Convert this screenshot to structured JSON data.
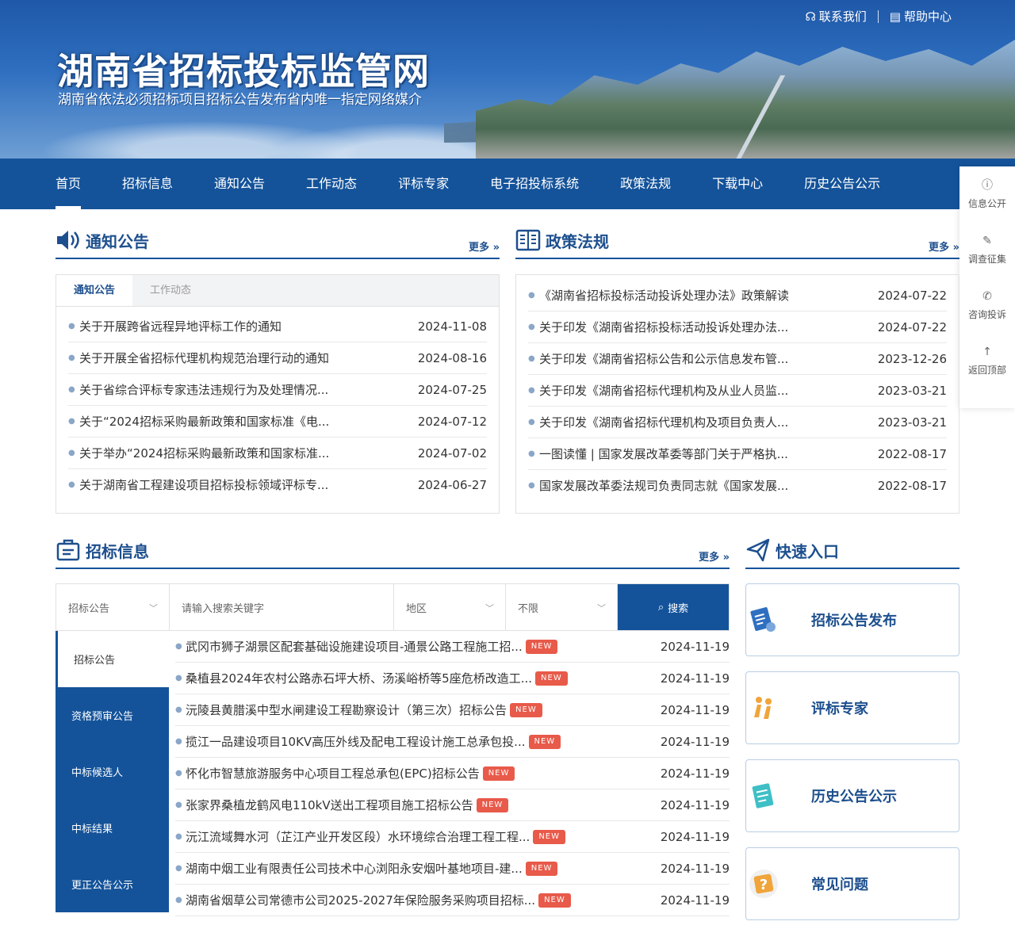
{
  "header": {
    "title": "湖南省招标投标监管网",
    "subtitle": "湖南省依法必须招标项目招标公告发布省内唯一指定网络媒介",
    "links": [
      "联系我们",
      "帮助中心"
    ]
  },
  "nav": [
    "首页",
    "招标信息",
    "通知公告",
    "工作动态",
    "评标专家",
    "电子招投标系统",
    "政策法规",
    "下载中心",
    "历史公告公示"
  ],
  "sidebar": [
    "信息公开",
    "调查征集",
    "咨询投诉",
    "返回顶部"
  ],
  "notices": {
    "title": "通知公告",
    "more": "更多",
    "tabs": [
      "通知公告",
      "工作动态"
    ],
    "items": [
      {
        "title": "关于开展跨省远程异地评标工作的通知",
        "date": "2024-11-08"
      },
      {
        "title": "关于开展全省招标代理机构规范治理行动的通知",
        "date": "2024-08-16"
      },
      {
        "title": "关于省综合评标专家违法违规行为及处理情况...",
        "date": "2024-07-25"
      },
      {
        "title": "关于“2024招标采购最新政策和国家标准《电...",
        "date": "2024-07-12"
      },
      {
        "title": "关于举办“2024招标采购最新政策和国家标准...",
        "date": "2024-07-02"
      },
      {
        "title": "关于湖南省工程建设项目招标投标领域评标专...",
        "date": "2024-06-27"
      }
    ]
  },
  "policy": {
    "title": "政策法规",
    "more": "更多",
    "items": [
      {
        "title": "《湖南省招标投标活动投诉处理办法》政策解读",
        "date": "2024-07-22"
      },
      {
        "title": "关于印发《湖南省招标投标活动投诉处理办法...",
        "date": "2024-07-22"
      },
      {
        "title": "关于印发《湖南省招标公告和公示信息发布管...",
        "date": "2023-12-26"
      },
      {
        "title": "关于印发《湖南省招标代理机构及从业人员监...",
        "date": "2023-03-21"
      },
      {
        "title": "关于印发《湖南省招标代理机构及项目负责人...",
        "date": "2023-03-21"
      },
      {
        "title": "一图读懂 | 国家发展改革委等部门关于严格执...",
        "date": "2022-08-17"
      },
      {
        "title": "国家发展改革委法规司负责同志就《国家发展...",
        "date": "2022-08-17"
      }
    ]
  },
  "bidding": {
    "title": "招标信息",
    "more": "更多",
    "search": {
      "type": "招标公告",
      "keyword_placeholder": "请输入搜索关键字",
      "region": "地区",
      "limit": "不限",
      "button": "搜索"
    },
    "categories": [
      "招标公告",
      "资格预审公告",
      "中标候选人",
      "中标结果",
      "更正公告公示"
    ],
    "badge": "NEW",
    "items": [
      {
        "title": "武冈市狮子湖景区配套基础设施建设项目-通景公路工程施工招...",
        "date": "2024-11-19"
      },
      {
        "title": "桑植县2024年农村公路赤石坪大桥、汤溪峪桥等5座危桥改造工...",
        "date": "2024-11-19"
      },
      {
        "title": "沅陵县黄腊溪中型水闸建设工程勘察设计（第三次）招标公告",
        "date": "2024-11-19"
      },
      {
        "title": "揽江一品建设项目10KV高压外线及配电工程设计施工总承包投...",
        "date": "2024-11-19"
      },
      {
        "title": "怀化市智慧旅游服务中心项目工程总承包(EPC)招标公告",
        "date": "2024-11-19"
      },
      {
        "title": "张家界桑植龙鹤风电110kV送出工程项目施工招标公告",
        "date": "2024-11-19"
      },
      {
        "title": "沅江流域舞水河（芷江产业开发区段）水环境综合治理工程工程...",
        "date": "2024-11-19"
      },
      {
        "title": "湖南中烟工业有限责任公司技术中心浏阳永安烟叶基地项目-建...",
        "date": "2024-11-19"
      },
      {
        "title": "湖南省烟草公司常德市公司2025-2027年保险服务采购项目招标...",
        "date": "2024-11-19"
      }
    ]
  },
  "quick": {
    "title": "快速入口",
    "items": [
      "招标公告发布",
      "评标专家",
      "历史公告公示",
      "常见问题"
    ]
  }
}
